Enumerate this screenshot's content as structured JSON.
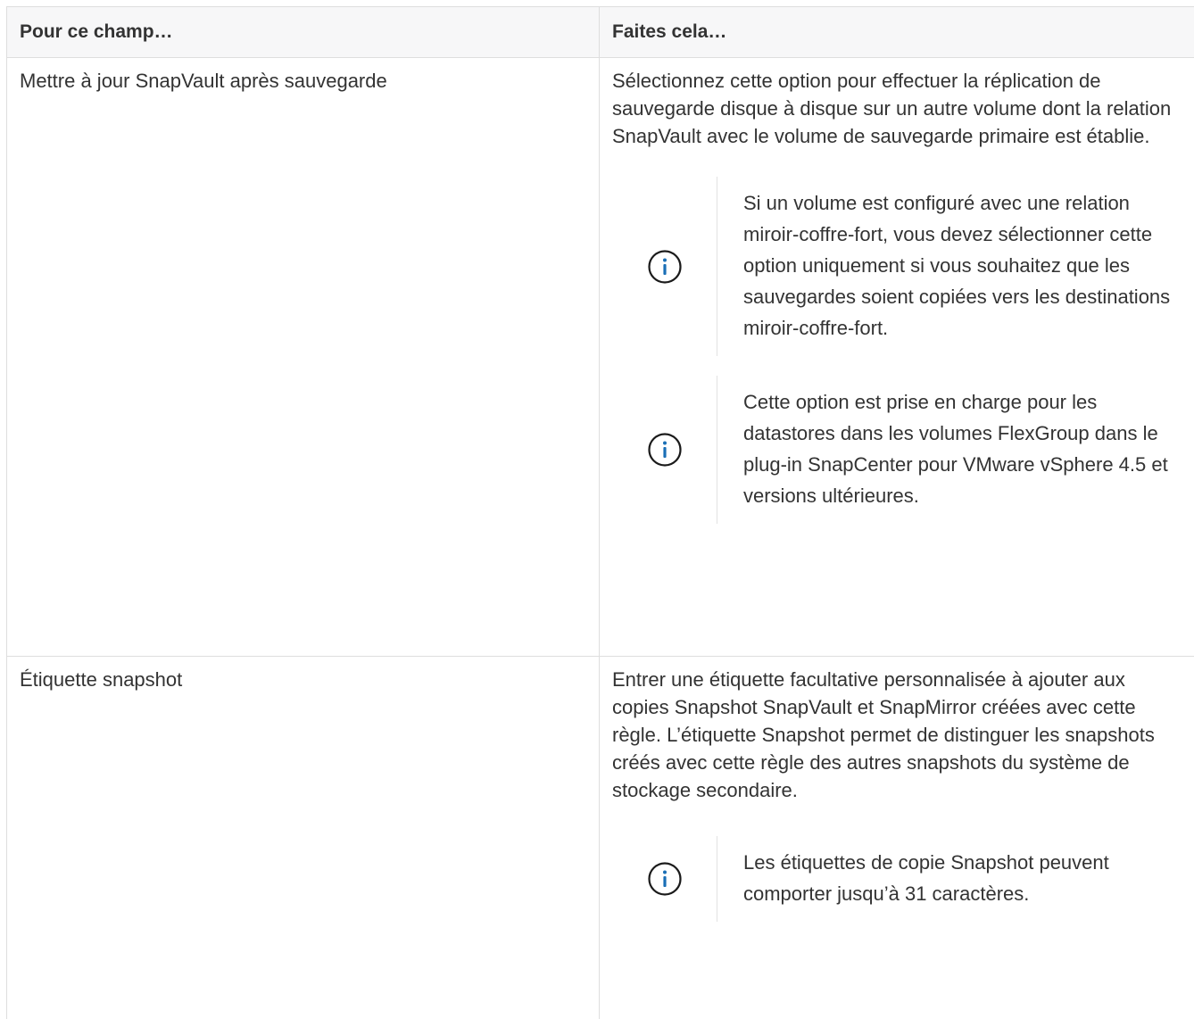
{
  "table": {
    "headers": [
      "Pour ce champ…",
      "Faites cela…"
    ],
    "rows": [
      {
        "field": "Mettre à jour SnapVault après sauvegarde",
        "description": "Sélectionnez cette option pour effectuer la réplication de sauvegarde disque à disque sur un autre volume dont la relation SnapVault avec le volume de sauvegarde primaire est établie.",
        "notes": [
          "Si un volume est configuré avec une relation miroir-coffre-fort, vous devez sélectionner cette option uniquement si vous souhaitez que les sauvegardes soient copiées vers les destinations miroir-coffre-fort.",
          "Cette option est prise en charge pour les datastores dans les volumes FlexGroup dans le plug-in SnapCenter pour VMware vSphere 4.5 et versions ultérieures."
        ]
      },
      {
        "field": "Étiquette snapshot",
        "description": "Entrer une étiquette facultative personnalisée à ajouter aux copies Snapshot SnapVault et SnapMirror créées avec cette règle. L’étiquette Snapshot permet de distinguer les snapshots créés avec cette règle des autres snapshots du système de stockage secondaire.",
        "notes": [
          "Les étiquettes de copie Snapshot peuvent comporter jusqu’à 31 caractères."
        ]
      }
    ]
  },
  "colors": {
    "info_icon": "#1a6fb6",
    "header_bg": "#f7f7f8",
    "border": "#dedede",
    "text": "#333333"
  },
  "icons": {
    "note": "info-circle-icon"
  }
}
